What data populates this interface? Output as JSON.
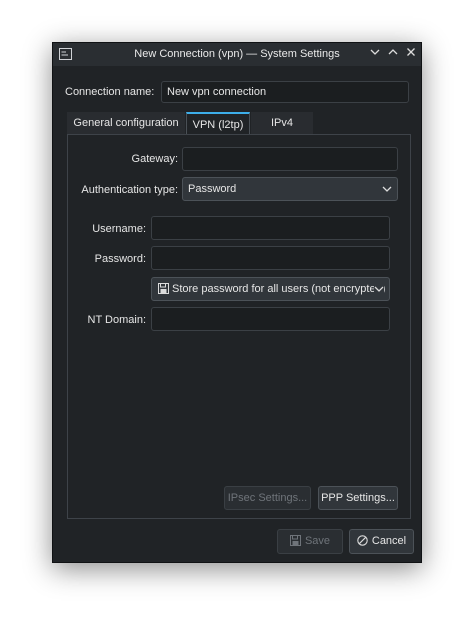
{
  "window": {
    "title": "New Connection (vpn) — System Settings"
  },
  "connection": {
    "label": "Connection name:",
    "value": "New vpn connection"
  },
  "tabs": [
    {
      "label": "General configuration",
      "active": false
    },
    {
      "label": "VPN (l2tp)",
      "active": true
    },
    {
      "label": "IPv4",
      "active": false
    }
  ],
  "vpn": {
    "gateway_label": "Gateway:",
    "gateway_value": "",
    "auth_label": "Authentication type:",
    "auth_value": "Password",
    "username_label": "Username:",
    "username_value": "",
    "password_label": "Password:",
    "password_value": "",
    "store_option": "Store password for all users (not encrypted)",
    "ntdomain_label": "NT Domain:",
    "ntdomain_value": "",
    "ipsec_button": "IPsec Settings...",
    "ppp_button": "PPP Settings..."
  },
  "footer": {
    "save_label": "Save",
    "cancel_label": "Cancel"
  },
  "colors": {
    "accent": "#3daee9",
    "window_bg": "#202326",
    "titlebar_bg": "#2a2e32"
  }
}
